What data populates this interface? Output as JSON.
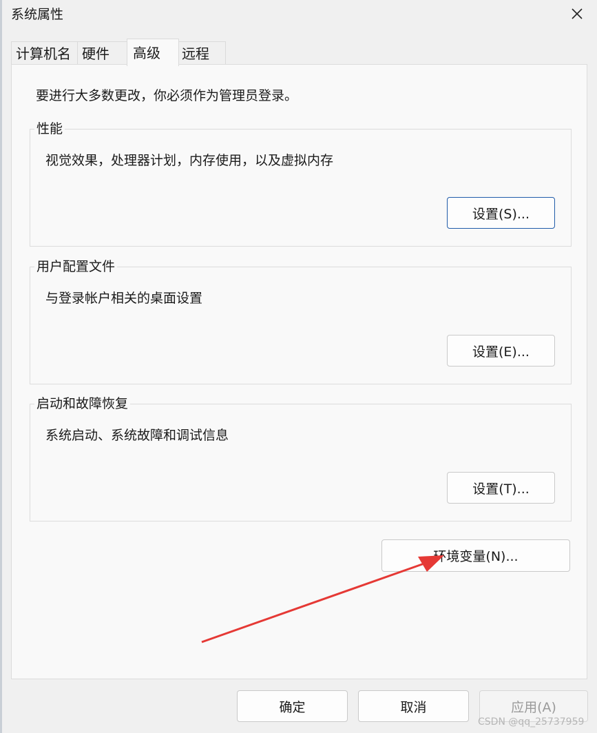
{
  "window": {
    "title": "系统属性",
    "close_icon": "close-icon"
  },
  "tabs": [
    {
      "label": "计算机名"
    },
    {
      "label": "硬件"
    },
    {
      "label": "高级",
      "active": true
    },
    {
      "label": "远程"
    }
  ],
  "intro": "要进行大多数更改，你必须作为管理员登录。",
  "groups": {
    "performance": {
      "title": "性能",
      "desc": "视觉效果，处理器计划，内存使用，以及虚拟内存",
      "button": "设置(S)..."
    },
    "profiles": {
      "title": "用户配置文件",
      "desc": "与登录帐户相关的桌面设置",
      "button": "设置(E)..."
    },
    "startup": {
      "title": "启动和故障恢复",
      "desc": "系统启动、系统故障和调试信息",
      "button": "设置(T)..."
    }
  },
  "env_button": "环境变量(N)...",
  "footer": {
    "ok": "确定",
    "cancel": "取消",
    "apply": "应用(A)",
    "apply_enabled": false
  },
  "annotation": {
    "type": "arrow",
    "color": "#e53935",
    "points_to": "env_button"
  },
  "watermark": "CSDN @qq_25737959",
  "colors": {
    "accent_border": "#1e5aa8",
    "panel_bg": "#f9f9f9",
    "window_bg": "#f0f0f0"
  }
}
